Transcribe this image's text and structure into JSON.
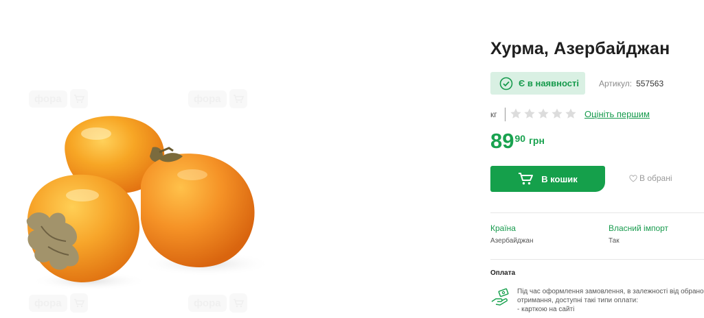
{
  "gallery": {
    "watermark_text": "фора",
    "image_alt": "persimmon-fruit-photo"
  },
  "product": {
    "title": "Хурма, Азербайджан",
    "stock_status": "Є в наявності",
    "sku_label": "Артикул:",
    "sku_value": "557563",
    "unit": "кг",
    "rating": {
      "value": 0,
      "max": 5
    },
    "rate_first_label": "Оцініть першим",
    "price_main": "89",
    "price_cents": "90",
    "currency": "грн",
    "add_to_cart_label": "В кошик",
    "favorite_label": "В обрані"
  },
  "attributes": [
    {
      "label": "Країна",
      "value": "Азербайджан"
    },
    {
      "label": "Власний імпорт",
      "value": "Так"
    }
  ],
  "payment": {
    "title": "Оплата",
    "lines": [
      "Під час оформлення замовлення, в залежності від обрано",
      "отримання, доступні такі типи оплати:",
      "- карткою на сайті"
    ]
  },
  "colors": {
    "accent_green": "#15a04b",
    "stock_bg": "#d9f0e3",
    "persimmon": "#f39a1e"
  }
}
